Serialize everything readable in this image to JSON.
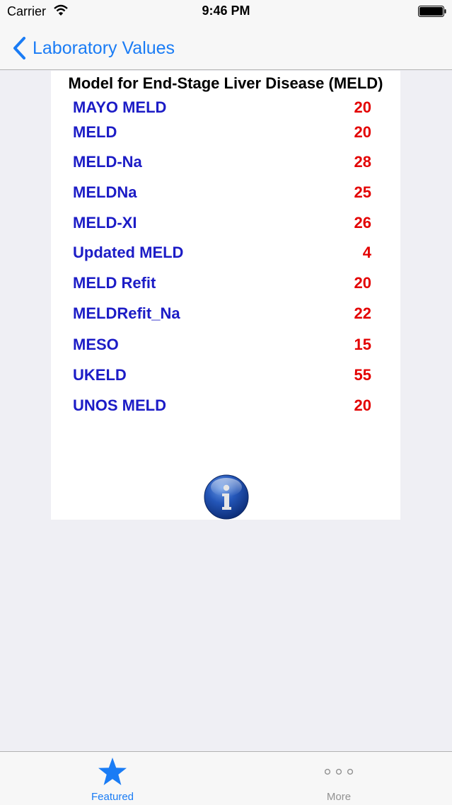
{
  "status_bar": {
    "carrier": "Carrier",
    "time": "9:46 PM"
  },
  "nav": {
    "back_label": "Laboratory Values"
  },
  "card": {
    "title": "Model for End-Stage Liver Disease (MELD)",
    "rows": [
      {
        "label": "MAYO MELD",
        "value": "20"
      },
      {
        "label": "MELD",
        "value": "20"
      },
      {
        "label": "MELD-Na",
        "value": "28"
      },
      {
        "label": "MELDNa",
        "value": "25"
      },
      {
        "label": "MELD-XI",
        "value": "26"
      },
      {
        "label": "Updated MELD",
        "value": "4"
      },
      {
        "label": "MELD Refit",
        "value": "20"
      },
      {
        "label": "MELDRefit_Na",
        "value": "22"
      },
      {
        "label": "MESO",
        "value": "15"
      },
      {
        "label": "UKELD",
        "value": "55"
      },
      {
        "label": "UNOS MELD",
        "value": "20"
      }
    ],
    "info_icon": "info-icon"
  },
  "tab_bar": {
    "tabs": [
      {
        "label": "Featured",
        "icon": "star-icon",
        "selected": true
      },
      {
        "label": "More",
        "icon": "more-icon",
        "selected": false
      }
    ]
  },
  "colors": {
    "accent": "#1a7cf5",
    "row_label": "#1c1cc6",
    "row_value": "#e30000"
  }
}
